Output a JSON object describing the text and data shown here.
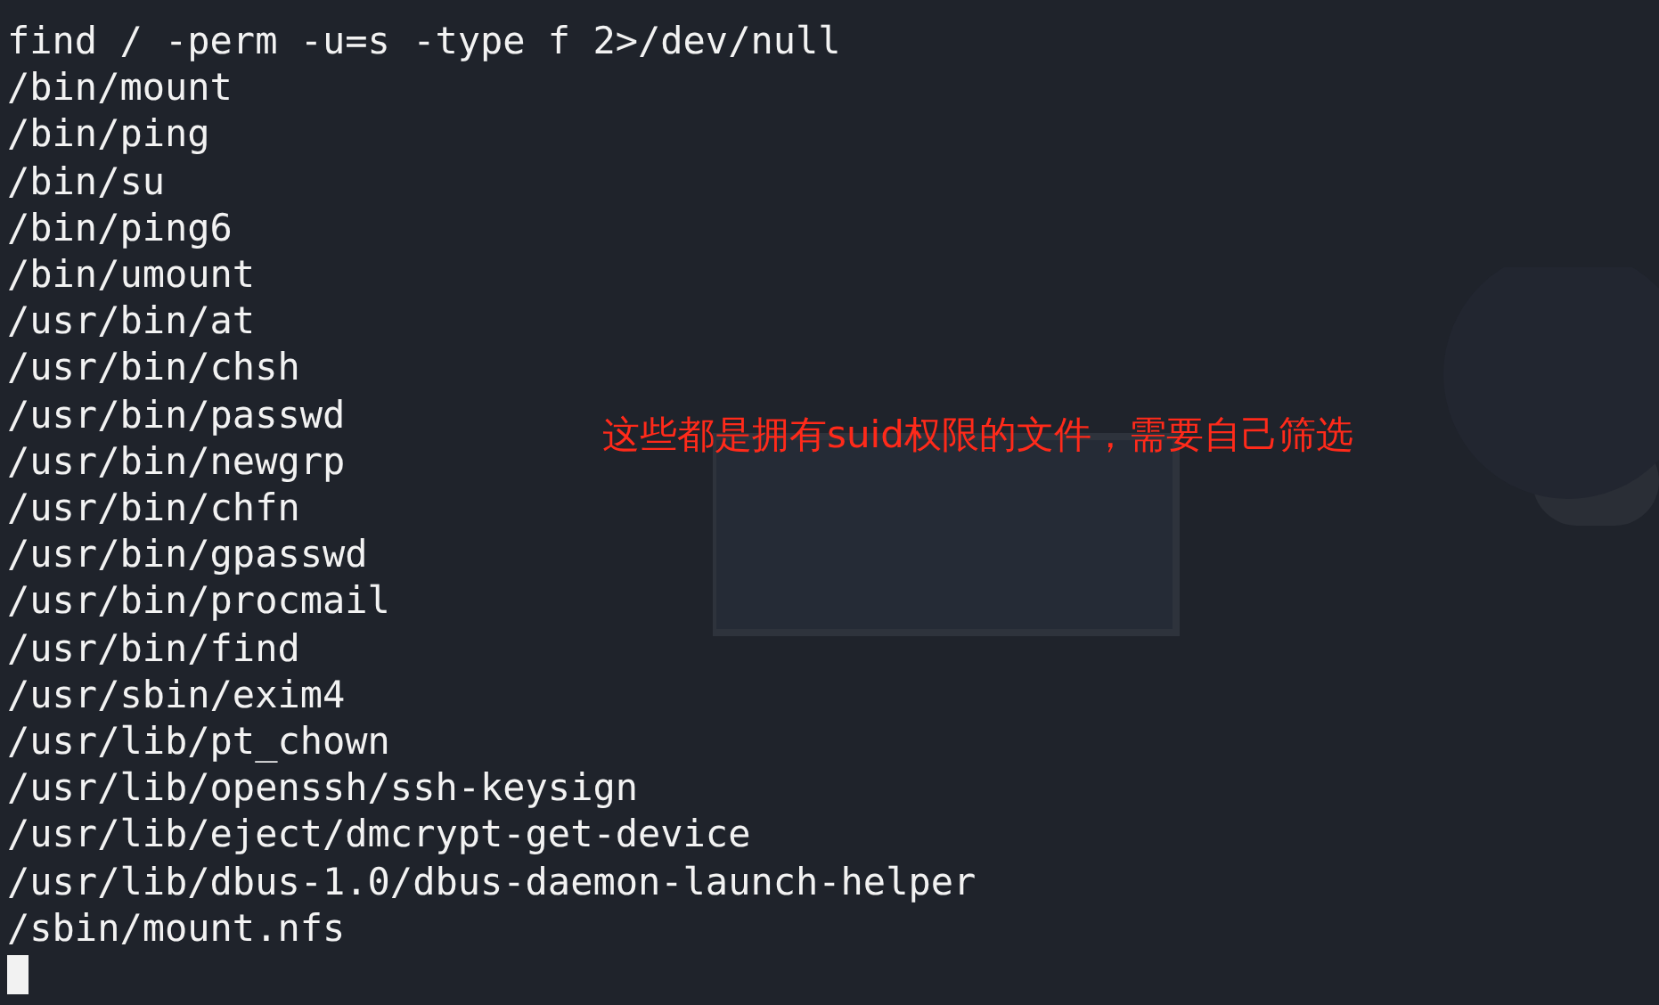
{
  "terminal": {
    "command": "find / -perm -u=s -type f 2>/dev/null",
    "output": [
      "/bin/mount",
      "/bin/ping",
      "/bin/su",
      "/bin/ping6",
      "/bin/umount",
      "/usr/bin/at",
      "/usr/bin/chsh",
      "/usr/bin/passwd",
      "/usr/bin/newgrp",
      "/usr/bin/chfn",
      "/usr/bin/gpasswd",
      "/usr/bin/procmail",
      "/usr/bin/find",
      "/usr/sbin/exim4",
      "/usr/lib/pt_chown",
      "/usr/lib/openssh/ssh-keysign",
      "/usr/lib/eject/dmcrypt-get-device",
      "/usr/lib/dbus-1.0/dbus-daemon-launch-helper",
      "/sbin/mount.nfs"
    ]
  },
  "annotation": "这些都是拥有suid权限的文件，需要自己筛选"
}
